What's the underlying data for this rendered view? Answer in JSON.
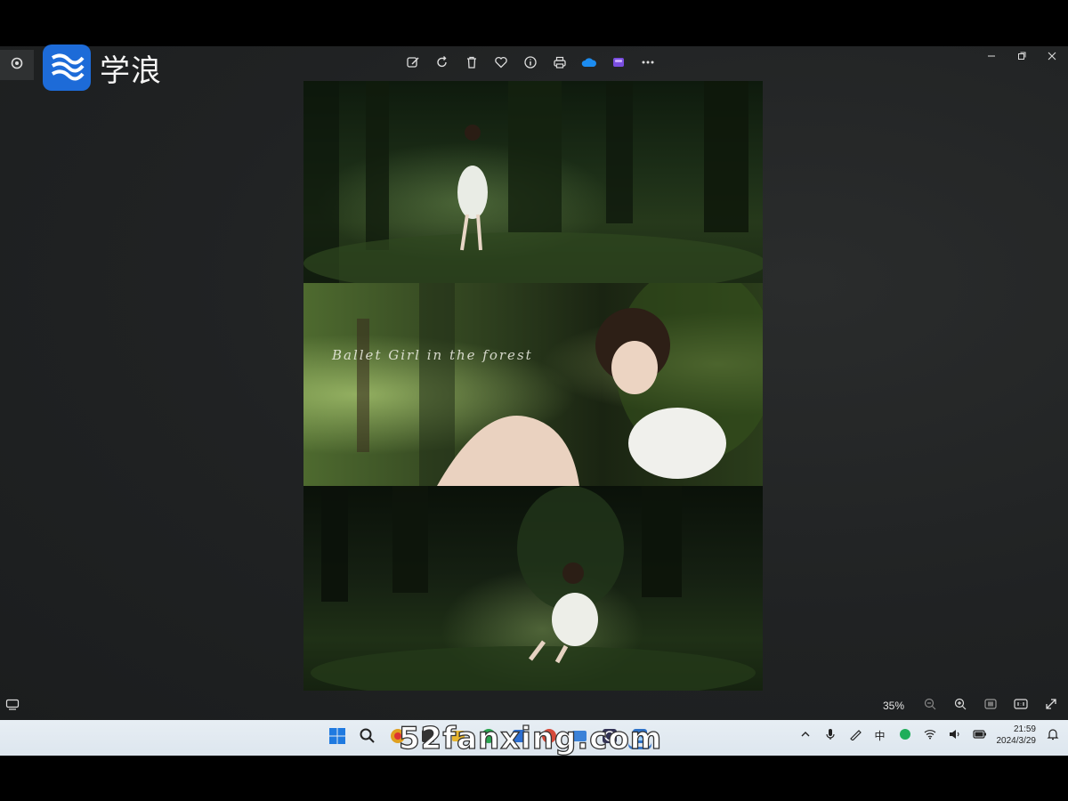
{
  "brand": {
    "name": "学浪"
  },
  "viewer": {
    "toolbar": [
      "edit-icon",
      "rotate-icon",
      "delete-icon",
      "favorite-icon",
      "info-icon",
      "print-icon",
      "onedrive-icon",
      "clipchamp-icon",
      "more-icon"
    ],
    "image_caption": "Ballet Girl in the forest",
    "zoom": "35%"
  },
  "watermark": "52fanxing.com",
  "taskbar": {
    "ime": "中",
    "time": "21:59",
    "date": "2024/3/29"
  },
  "colors": {
    "brand_blue": "#1d6bd8",
    "accent": "#3b78c8",
    "viewer_bg": "#202223"
  }
}
